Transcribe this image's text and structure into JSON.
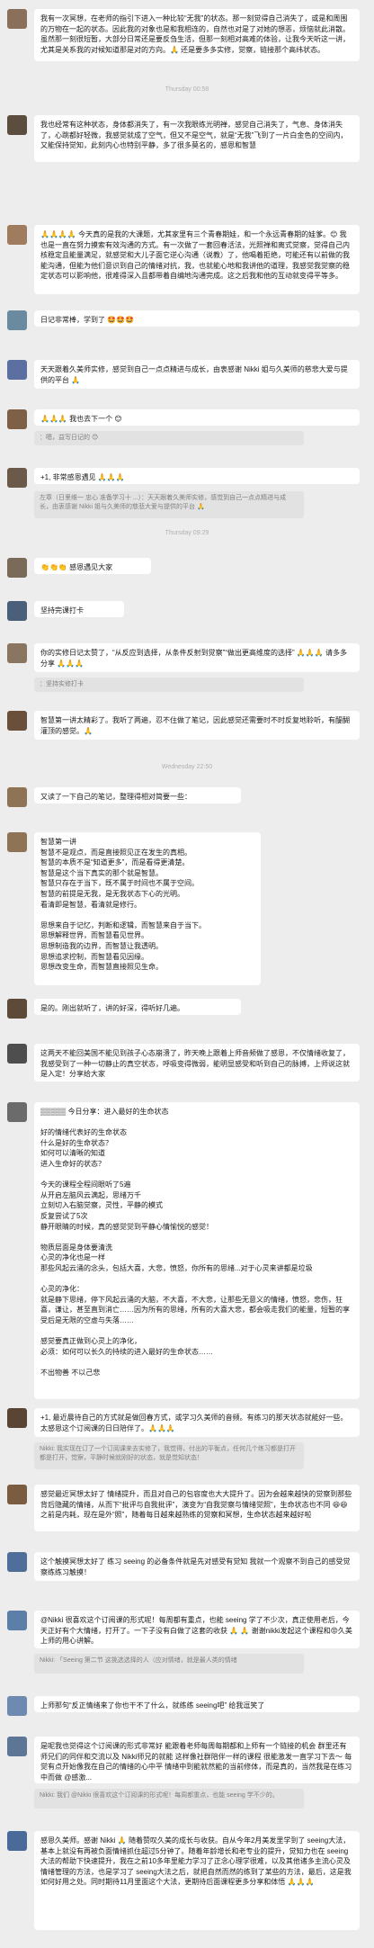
{
  "colors": {
    "background": "#ededed",
    "bubble": "#ffffff",
    "quote": "#e2e2e2",
    "timestamp": "#b0b0b0"
  },
  "messages": [
    {
      "text": "我有一次冥想，在老师的指引下进入一种比较“无我”的状态。那一刻觉得自己消失了，或是和周围的万物在一起的状态。因此我的对象也是和我相连的，自然也对是了对她的想恶，烦恼就此消散。虽然那一刻很短暂，大部分日常还是要反刍生活，但那一刻相对高难的体验，让我今天听这一讲，尤其是关系我的对候知道那是对的方向。🙏 还是要多多实修，觉察，链接那个高纬状态。",
      "avatar_color": "#8a6f5a"
    },
    {
      "time": "Thursday 00:58"
    },
    {
      "text": "我也经常有这种状态，身体都消失了，有一次我眼练光明禅，感觉自己消失了，气息、身体消失了，心跳都好轻微，我感觉就成了空气，但又不是空气，就是“无我”飞到了一片白金色的空间内，又能保持觉知，此刻内心也特别平静，多了很多莫名的，感恩和智慧",
      "avatar_color": "#5b4e3e"
    },
    {
      "text": "🙏🙏🙏🙏 今天真的是我的大课题，尤其家里有三个青春期娃，和一个永远青春期的娃爹。😊 我也是一直在努力摸索有效沟通的方式。有一次做了一套回春活法，光照禅和离式觉察，觉得自己内核稳定且能量满足，就感觉和大儿子面它逆心沟通（说教）了，他喝着拒绝，可能还有以前做的我能沟通，但能为他们意识到自己的情绪对抗，我，也就能心地和我讲他的道理，我感觉我觉察的稳定状态可以影响他，很难得深入且都带着自编地沟通完成。这之后我和他的互动就变得平等多。",
      "avatar_color": "#a07c5e"
    },
    {
      "text": "日记非常棒，学到了 🤩🤩🤩",
      "avatar_color": "#6a8aa0"
    },
    {
      "text": "天天跟着久美师实修，感觉到自己一点点精进与成长，由衷感谢 Nikki 姐与久美师的慈悲大爱与提供的平台 🙏",
      "avatar_color": "#5b6fa0"
    },
    {
      "text": "🙏🙏🙏 我也去下一个 😊",
      "avatar_color": "#7e6046"
    },
    {
      "quote": "：嗯，益写日记的 😊"
    },
    {
      "text": "+1, 非常感恩遇见 🙏🙏🙏",
      "avatar_color": "#6b5a4a"
    },
    {
      "quote": "左章（日里维一 忠心 准备学习十 ...）：天天跟着久美师实修，感觉到自己一点点精进与成长，由衷感谢 Nikki 姐与久美师的慈悲大爱与提供的平台 🙏"
    },
    {
      "time": "Thursday 09:29"
    },
    {
      "text": "👏👏👏 感恩遇见大家",
      "avatar_color": "#7a6a5a"
    },
    {
      "text": "坚持完课打卡",
      "avatar_color": "#4a5f7a"
    },
    {
      "text": "你的实修日记太赞了，“从反应到选择，从条件反射到觉察”“做出更高维度的选择” 🙏🙏🙏 请多多分享 🙏🙏🙏",
      "avatar_color": "#8a7560"
    },
    {
      "quote": "：坚持实修打卡"
    },
    {
      "text": "智慧第一讲太精彩了。我听了两遍，忍不住做了笔记，因此感觉还需要时不时反复地聆听，有醍醐灌顶的感觉。🙏",
      "avatar_color": "#6a4f3a"
    },
    {
      "time": "Wednesday 22:50"
    },
    {
      "text": "又读了一下自己的笔记，整理得相对简要一些：",
      "avatar_color": "#8f7355"
    },
    {
      "text": "智慧第一讲\n智慧不是观点，而是直接照见正在发生的真相。\n智慧的本质不是“知道更多”，而是看得更清楚。\n智慧是这个当下真实的那个就是智慧。\n智慧只存在于当下，既不属于时间也不属于空间。\n智慧的前提是无我，是无我状态下心的光明。\n看清即是智慧，看清就是修行。\n\n思想来自于记忆，判断和逻辑，而智慧来自于当下。\n思想解释世界，而智慧看见世界。\n思想制造我的边界，而智慧让我透明。\n思想追求控制，而智慧看见因缘。\n思想改变生命，而智慧直接照见生命。",
      "avatar_color": "#8f7355"
    },
    {
      "text": "是的。刚出就听了，讲的好深，得听好几遍。",
      "avatar_color": "#5e4a38"
    },
    {
      "text": "这两天不能回美国不能见到孩子心态崩溃了，昨天晚上跟着上师音频做了感恩，不仅情绪收复了，我感受到了一种一切静止的真空状态，呼吸变得微弱，能明显感受和听到自己的脉搏，上师说这就是入定！分享给大家",
      "avatar_color": "#4e4e4e"
    },
    {
      "text": "▒▒▒▒▒ 今日分享：进入最好的生命状态\n\n好的情绪代表好的生命状态\n什么是好的生命状态？\n如何可以清晰的知道\n进入生命好的状态？\n\n今天的课程全程间眼听了5遍\n从开启左脑风云满起，思绪万千\n立刻切入右脑觉察，灵性，平静的模式\n反复尝试了5次\n静开眼睛的时候，真的感觉觉到平静心情愉悦的感觉！\n\n物质层面是身体要清洗\n心灵的净化也是一样\n那些风起云涌的念头，包括大喜，大悲，愤怒，你所有的思绪...对于心灵来讲都是垃圾\n\n心灵的净化：\n就是静下思绪，停下风起云涌的大脑，不大喜，不大悲，让那些无意义的情绪，愤怒，悲伤，狂喜，谦让，甚至直到消亡……因为所有的思绪，所有的大喜大悲，都会吸走我们的能量，短暂的享受后是无限的空虚与失落……\n\n感觉要真正做到心灵上的净化，\n必须：如何可以长久的持续的进入最好的生命状态……\n\n不出物善 不以己悲",
      "avatar_color": "#6b6b6b"
    },
    {
      "text": "+1, 最近晨待自己的方式就是做回春方式，或学习久美师的音频。有练习的那天状态就能好一些。太感恩这个订阅课的日日陪伴了。🙏🙏🙏",
      "avatar_color": "#5a4535"
    },
    {
      "quote": "Nikki: 我实现在订了一个订阅课来去实修了，我觉得，付出的平衡点，任何几个练习都是打开都是打开，觉察，平静时候就刚好的状态，就是觉知状态！"
    },
    {
      "text": "感觉最近冥想太好了 情绪提升，而且对自己的包容度也大大提升了。因为会越来越快的觉察到那些背后隐藏的情绪，从而下“批评与自我批评”，演变为“自我觉察与情绪觉照”，生命状态也不同 😆😆之前是内耗，现在是外“照”，随着每日越来越熟练的觉察和冥想，生命状态越来越好啦",
      "avatar_color": "#7a5c40"
    },
    {
      "text": "这个触摸冥想太好了 练习 seeing 的必备条件就是先对感受有觉知 我就一个观察不到自己的感受觉察练练习触摸！",
      "avatar_color": "#4f6f9a"
    },
    {
      "text": "@Nikki 很喜欢这个订阅课的形式呢！每周都有重点，也能 seeing 学了不少次，真正使用老后，今天正好有个大情绪，打开了。一下子没有白做了这套的收获 🙏 🙏 谢谢nikki发起这个课程和😡久美 上师的用心讲解。",
      "avatar_color": "#5c7fa8"
    },
    {
      "quote": "Nikki: 「Seeing 第二节 这挑选选择的人（应对情绪，就是最人类的情绪"
    },
    {
      "text": "上师那句“反正情绪来了你也干不了什么，就练练 seeing吧” 给我逗笑了",
      "avatar_color": "#6f8ab0"
    },
    {
      "text": "是呢我也觉得这个订阅课的形式非常好 能跟着老师每周每期都和上师有一个链接的机会 群里还有师兄们的同伴和交流以及 Nikki师兄的就能 这样像社群陪伴一样的课程 很能激发一直学习下去～ 每觉有点开始像我在自己的情绪的心中平 情绪中到能就然能的当前修体，而是真的，当然我是在练习中而做 @感激...",
      "avatar_color": "#5d7695"
    },
    {
      "quote": "Nikki: 我们 @Nikki 很喜欢这个订阅课的形式呢！每周都重点，也能 seeing 学不少的。"
    },
    {
      "text": "感恩久美师。感谢 Nikki 🙏 随着赞叹久美的成长与收获。自从今年2月美发里学到了 seeing大法，基本上就没有再被负面情绪抓住超过5分钟了。随着年龄增长和老专业的提升，觉知力也在 seeing大法的帮助下快速提升，我在之前10多年里能力学习了正念心理学很难，以及其他诸多主流心灵及情绪管理的方法，也是学习了 seeing大法之后，就把自然而然的练到了某些的方法，最后，这是我如何好用之处。同时期待11月里面这个大法，更期待后面课程更多分享和体悟 🙏🙏🙏",
      "avatar_color": "#4a6a9a"
    }
  ]
}
